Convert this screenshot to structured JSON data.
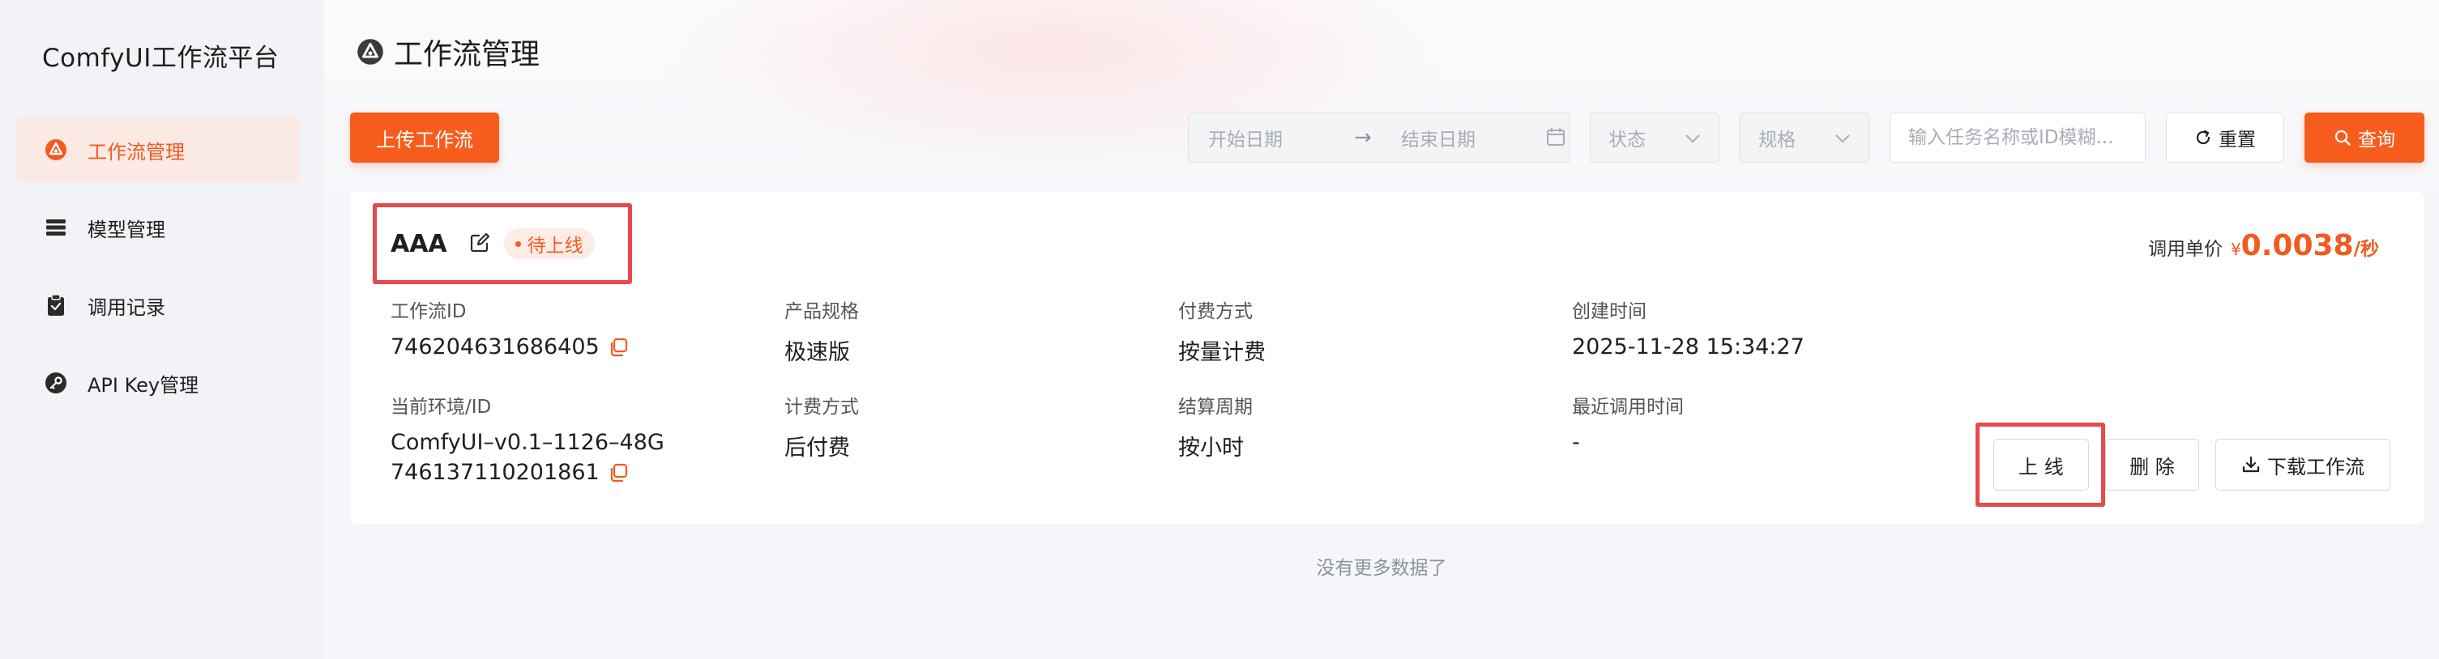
{
  "sidebar": {
    "app_title": "ComfyUI工作流平台",
    "items": [
      {
        "label": "工作流管理",
        "icon": "workflow-icon",
        "active": true
      },
      {
        "label": "模型管理",
        "icon": "layers-icon",
        "active": false
      },
      {
        "label": "调用记录",
        "icon": "clipboard-icon",
        "active": false
      },
      {
        "label": "API Key管理",
        "icon": "key-icon",
        "active": false
      }
    ]
  },
  "header": {
    "title": "工作流管理",
    "title_icon": "workflow-icon"
  },
  "toolbar": {
    "upload_label": "上传工作流",
    "start_date_placeholder": "开始日期",
    "range_arrow": "→",
    "end_date_placeholder": "结束日期",
    "status_placeholder": "状态",
    "spec_placeholder": "规格",
    "search_placeholder": "输入任务名称或ID模糊...",
    "reset_label": "重置",
    "query_label": "查询"
  },
  "workflow_card": {
    "name": "AAA",
    "status": "待上线",
    "price_label": "调用单价",
    "price_currency": "¥",
    "price_value": "0.0038",
    "price_unit": "/秒",
    "fields": {
      "workflow_id": {
        "label": "工作流ID",
        "value": "746204631686405"
      },
      "product_spec": {
        "label": "产品规格",
        "value": "极速版"
      },
      "payment_method": {
        "label": "付费方式",
        "value": "按量计费"
      },
      "created_time": {
        "label": "创建时间",
        "value": "2025-11-28 15:34:27"
      },
      "current_env": {
        "label": "当前环境/ID",
        "value": "ComfyUI–v0.1–1126–48G",
        "value_id": "746137110201861"
      },
      "billing_method": {
        "label": "计费方式",
        "value": "后付费"
      },
      "settlement_cycle": {
        "label": "结算周期",
        "value": "按小时"
      },
      "last_call_time": {
        "label": "最近调用时间",
        "value": "-"
      }
    },
    "actions": {
      "online_label": "上 线",
      "delete_label": "删 除",
      "download_label": "下载工作流"
    }
  },
  "footer_text": "没有更多数据了",
  "colors": {
    "accent": "#f65d1c",
    "highlight": "#e8494f",
    "active_nav_bg": "#fbe9e4"
  }
}
